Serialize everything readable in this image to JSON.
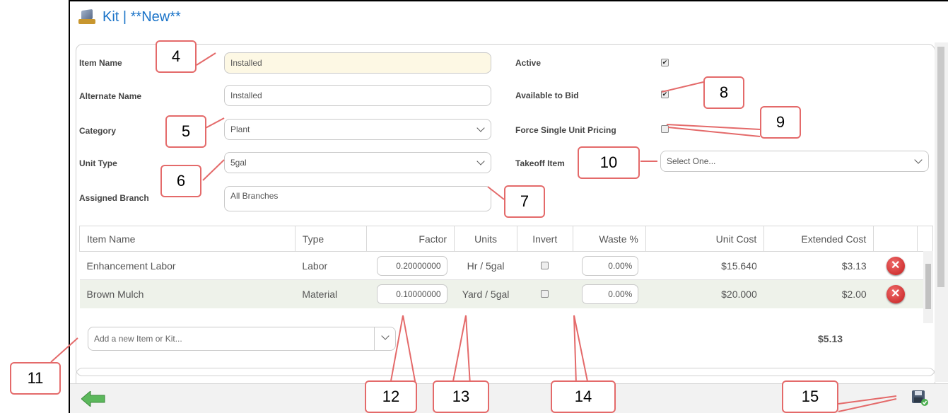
{
  "title": "Kit | **New**",
  "form": {
    "item_name_label": "Item Name",
    "item_name_value": "Installed",
    "alternate_name_label": "Alternate Name",
    "alternate_name_value": "Installed",
    "category_label": "Category",
    "category_value": "Plant",
    "unit_type_label": "Unit Type",
    "unit_type_value": "5gal",
    "assigned_branch_label": "Assigned Branch",
    "assigned_branch_value": "All Branches",
    "active_label": "Active",
    "active_checked": "✔",
    "available_label": "Available to Bid",
    "available_checked": "✔",
    "force_single_label": "Force Single Unit Pricing",
    "takeoff_label": "Takeoff Item",
    "takeoff_value": "Select One..."
  },
  "table": {
    "headers": [
      "Item Name",
      "Type",
      "Factor",
      "Units",
      "Invert",
      "Waste %",
      "Unit Cost",
      "Extended Cost"
    ],
    "rows": [
      {
        "name": "Enhancement Labor",
        "type": "Labor",
        "factor": "0.20000000",
        "units": "Hr / 5gal",
        "waste": "0.00%",
        "unit_cost": "$15.640",
        "extended": "$3.13"
      },
      {
        "name": "Brown Mulch",
        "type": "Material",
        "factor": "0.10000000",
        "units": "Yard / 5gal",
        "waste": "0.00%",
        "unit_cost": "$20.000",
        "extended": "$2.00"
      }
    ],
    "add_placeholder": "Add a new Item or Kit...",
    "total": "$5.13"
  },
  "callouts": [
    "4",
    "5",
    "6",
    "7",
    "8",
    "9",
    "10",
    "11",
    "12",
    "13",
    "14",
    "15"
  ],
  "colors": {
    "title": "#1a73c8",
    "callout_border": "#e46a6a",
    "delete": "#c41e1e",
    "back_arrow": "#5cb85c"
  }
}
